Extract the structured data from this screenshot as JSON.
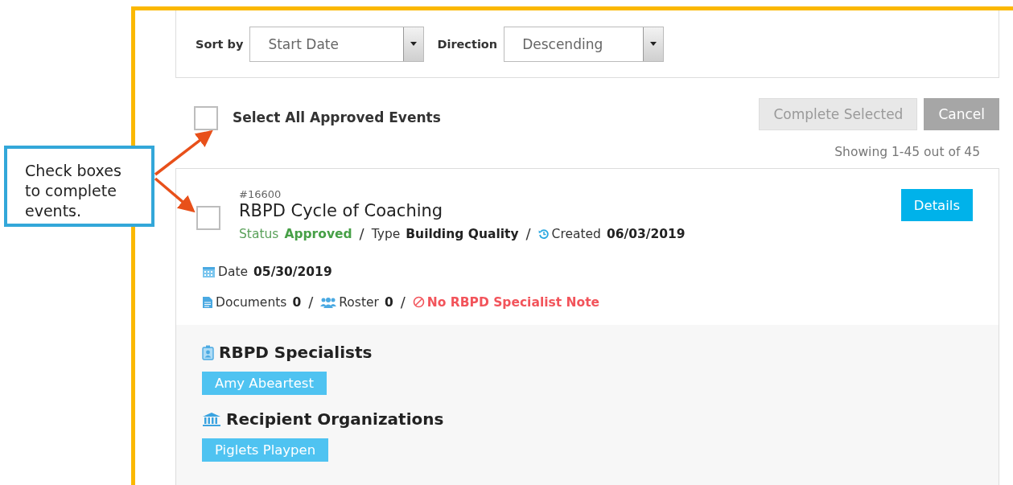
{
  "callout": {
    "text": "Check boxes to complete events."
  },
  "sort": {
    "label": "Sort by",
    "value": "Start Date"
  },
  "direction": {
    "label": "Direction",
    "value": "Descending"
  },
  "select_all": {
    "label": "Select All Approved Events",
    "checked": false
  },
  "buttons": [
    {
      "label": "Complete Selected",
      "disabled": true
    },
    {
      "label": "Cancel",
      "disabled": false
    }
  ],
  "showing": "Showing 1-45 out of 45",
  "events": [
    {
      "number": "#16600",
      "title": "RBPD Cycle of Coaching",
      "checked": false,
      "details_button": "Details",
      "line1": [
        {
          "kind": "status",
          "label": "Status",
          "value": "Approved"
        },
        {
          "kind": "sep",
          "text": "/"
        },
        {
          "kind": "type",
          "label": "Type",
          "value": "Building Quality"
        },
        {
          "kind": "sep",
          "text": "/"
        },
        {
          "kind": "created",
          "label": "Created",
          "value": "06/03/2019"
        }
      ],
      "line2": [
        {
          "kind": "date",
          "label": "Date",
          "value": "05/30/2019"
        }
      ],
      "line3": [
        {
          "kind": "documents",
          "label": "Documents",
          "value": "0"
        },
        {
          "kind": "sep",
          "text": "/"
        },
        {
          "kind": "roster",
          "label": "Roster",
          "value": "0"
        },
        {
          "kind": "sep",
          "text": "/"
        },
        {
          "kind": "note",
          "text": "No RBPD Specialist Note"
        }
      ],
      "sections": [
        {
          "kind": "specialists",
          "title": "RBPD Specialists",
          "tags": [
            "Amy Abeartest"
          ]
        },
        {
          "kind": "organizations",
          "title": "Recipient Organizations",
          "tags": [
            "Piglets Playpen"
          ]
        }
      ]
    }
  ]
}
